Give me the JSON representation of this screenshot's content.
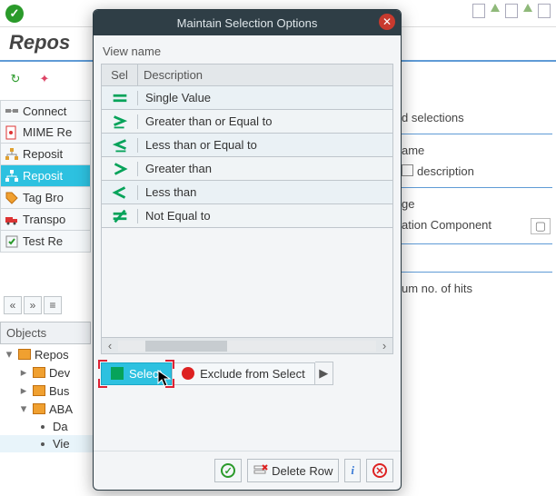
{
  "toolbar": {
    "repo_title": "Repos"
  },
  "nav": {
    "items": [
      {
        "label": "Connect"
      },
      {
        "label": "MIME Re"
      },
      {
        "label": "Reposit"
      },
      {
        "label": "Reposit"
      },
      {
        "label": "Tag Bro"
      },
      {
        "label": "Transpo"
      },
      {
        "label": "Test Re"
      }
    ]
  },
  "objects": {
    "header": "Objects",
    "tree": [
      {
        "label": "Repos",
        "level": 0,
        "expanded": true,
        "folder": true
      },
      {
        "label": "Dev",
        "level": 1,
        "expanded": false,
        "folder": true
      },
      {
        "label": "Bus",
        "level": 1,
        "expanded": false,
        "folder": true
      },
      {
        "label": "ABA",
        "level": 1,
        "expanded": true,
        "folder": true
      },
      {
        "label": "Da",
        "level": 2,
        "leaf": true
      },
      {
        "label": "Vie",
        "level": 2,
        "leaf": true,
        "selected": true
      }
    ]
  },
  "right": {
    "row1": "d selections",
    "row2": "ame",
    "row3": "description",
    "row4": "ge",
    "row5": "ation Component",
    "row6": "um no. of hits"
  },
  "dialog": {
    "title": "Maintain Selection Options",
    "section": "View name",
    "columns": {
      "sel": "Sel",
      "desc": "Description"
    },
    "options": [
      {
        "op": "eq",
        "label": "Single Value"
      },
      {
        "op": "ge",
        "label": "Greater than or Equal to"
      },
      {
        "op": "le",
        "label": "Less than or Equal to"
      },
      {
        "op": "gt",
        "label": "Greater than"
      },
      {
        "op": "lt",
        "label": "Less than"
      },
      {
        "op": "ne",
        "label": "Not Equal to"
      }
    ],
    "tabs": {
      "select": "Select",
      "exclude": "Exclude from Select"
    },
    "footer": {
      "delete_row": "Delete Row"
    }
  }
}
